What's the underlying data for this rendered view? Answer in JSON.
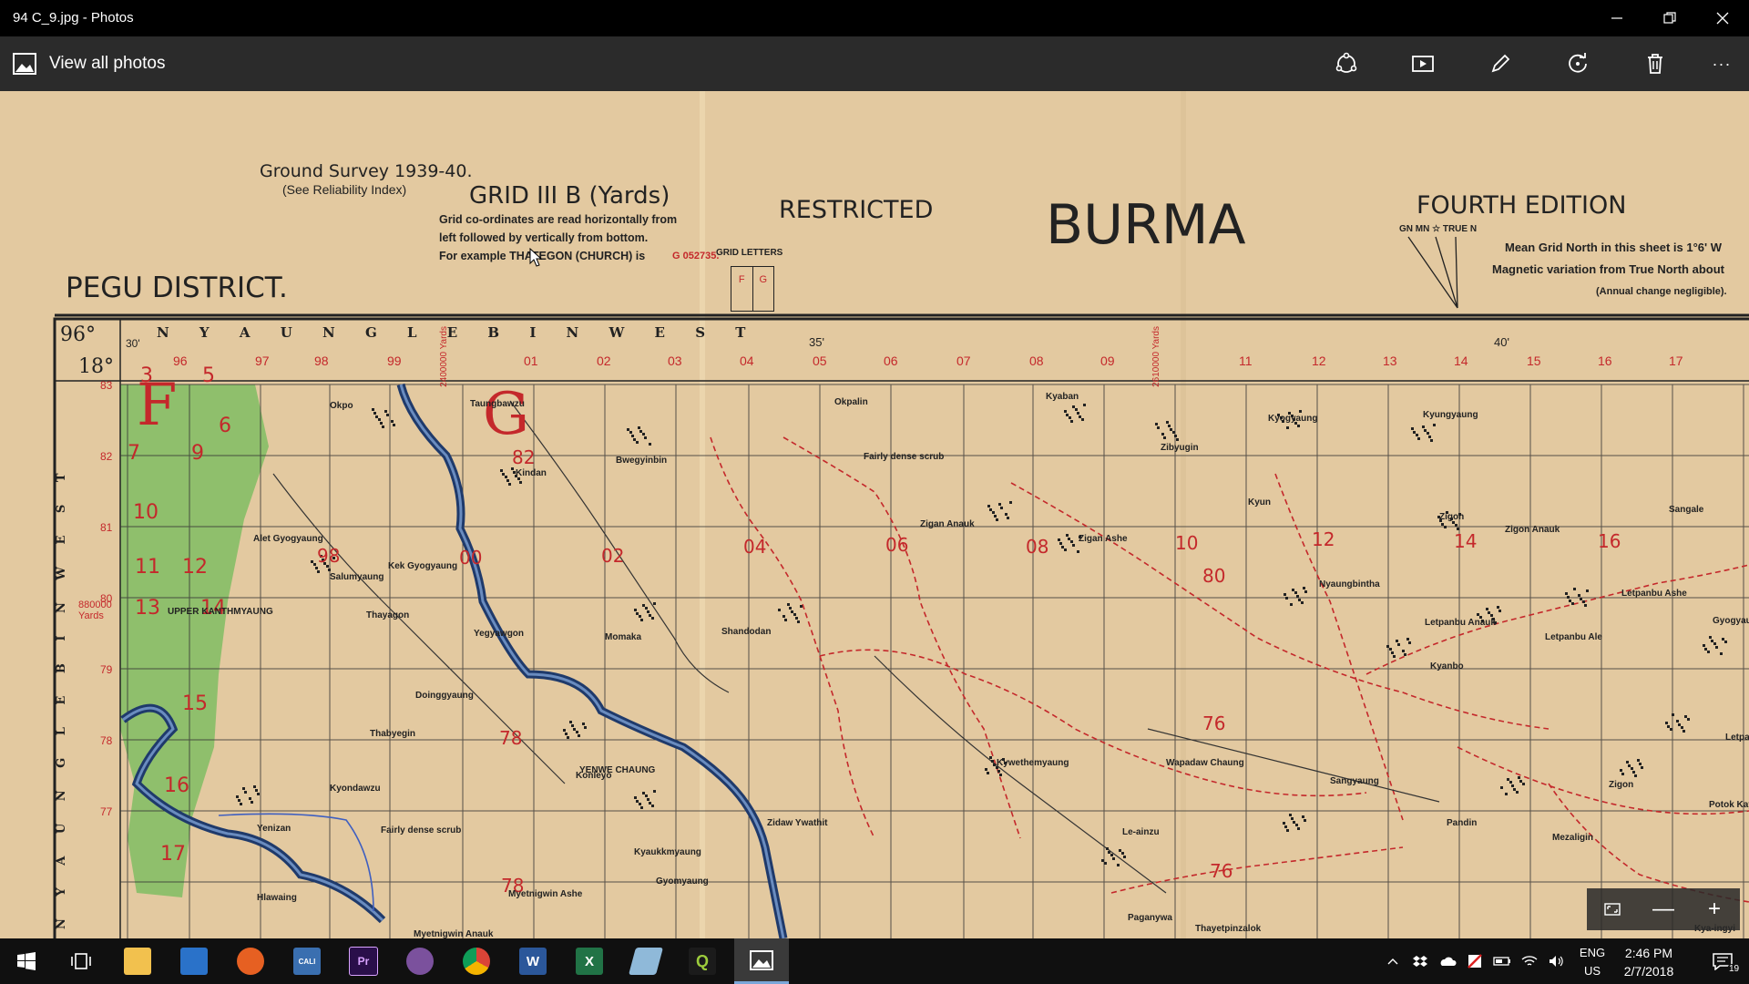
{
  "window": {
    "title": "94 C_9.jpg - Photos",
    "minimize_icon": "minimize-icon",
    "maximize_icon": "restore-icon",
    "close_icon": "close-icon"
  },
  "appbar": {
    "view_all_label": "View all photos",
    "tools": [
      "share-icon",
      "slideshow-icon",
      "edit-icon",
      "rotate-icon",
      "delete-icon",
      "more-icon"
    ],
    "more_label": "···"
  },
  "map": {
    "ground_survey": "Ground Survey 1939-40.",
    "reliability": "(See Reliability Index)",
    "grid_title": "GRID III B (Yards)",
    "grid_line1": "Grid co-ordinates are read horizontally from",
    "grid_line2": "left followed by vertically from bottom.",
    "grid_line3": "For example THATEGON (CHURCH) is",
    "grid_example": "G 052735.",
    "grid_letters": "GRID LETTERS",
    "grid_letter_f": "F",
    "grid_letter_g": "G",
    "restricted": "RESTRICTED",
    "country": "BURMA",
    "edition": "FOURTH EDITION",
    "north_labels": "GN MN ☆ TRUE N",
    "mean_grid": "Mean Grid North in this sheet is 1°6' W",
    "magnetic": "Magnetic variation from True North about",
    "annual": "(Annual change negligible).",
    "district": "PEGU DISTRICT.",
    "sheet_top": "N Y A U N G L E B I N   W E S T",
    "side_label": "N Y A U N G L E B I N   W E S T",
    "corner_96": "96°",
    "corner_18": "18°",
    "corner_30": "30'",
    "minute_35": "35'",
    "minute_40": "40'",
    "x_ticks": [
      "96",
      "97",
      "98",
      "99",
      "01",
      "02",
      "03",
      "04",
      "05",
      "06",
      "07",
      "08",
      "09",
      "11",
      "12",
      "13",
      "14",
      "15",
      "16",
      "17"
    ],
    "y_ticks": [
      "83",
      "82",
      "81",
      "80",
      "79",
      "78",
      "77"
    ],
    "yards_left": "880000 Yards",
    "yards_top1": "2400000 Yards",
    "yards_top2": "2610000 Yards",
    "red_labels": [
      "82",
      "02",
      "04",
      "06",
      "08",
      "10",
      "12",
      "14",
      "16",
      "80",
      "98",
      "78",
      "76",
      "78",
      "76",
      "00"
    ],
    "green_zone_numbers": [
      "3",
      "5",
      "6",
      "7",
      "9",
      "10",
      "11",
      "12",
      "13",
      "14",
      "15",
      "16",
      "17"
    ],
    "big_letters": [
      "F",
      "G"
    ],
    "places": [
      "Okpo",
      "Taungbawzu",
      "Kindan",
      "Bwegyinbin",
      "Okpalin",
      "Fairly dense scrub",
      "Kyaban",
      "Zibyugin",
      "Kyogyaung",
      "Kyungyaung",
      "Zigon",
      "Sangale",
      "Zigan Anauk",
      "Zigan Ashe",
      "Kyun",
      "Zigon Anauk",
      "Alet Gyogyaung",
      "Kek Gyogyaung",
      "Salumyaung",
      "Thayagon",
      "Yegyawgon",
      "Momaka",
      "Shandodan",
      "Nyaungbintha",
      "Letpanbu Ashe",
      "Letpanbu Anauk",
      "Letpanbu Ale",
      "Kyanbo",
      "Gyogyaung",
      "UPPER KANTHMYAUNG",
      "Doinggyaung",
      "Thabyegin",
      "Konleyo",
      "YENWE CHAUNG",
      "Kyaukkmyaung",
      "Gyomyaung",
      "Zidaw Ywathit",
      "Kywethemyaung",
      "Wapadaw Chaung",
      "Sangyaung",
      "Pandin",
      "Mezaligin",
      "Zigon",
      "Yenizan",
      "Kyondawzu",
      "Fairly dense scrub",
      "Hlawaing",
      "Myetnigwin Ashe",
      "Myetnigwin Anauk",
      "Le-ainzu",
      "Paganywa",
      "Thayetpinzalok",
      "Potok Kayin",
      "Kya-ingyi",
      "Letpan"
    ]
  },
  "zoom": {
    "fullscreen_icon": "fullscreen-icon",
    "minus": "—",
    "plus": "+"
  },
  "taskbar": {
    "apps": [
      "start-icon",
      "task-view-icon",
      "file-explorer-icon",
      "store-icon",
      "firefox-icon",
      "calibre-icon",
      "premiere-icon",
      "viber-icon",
      "chrome-icon",
      "word-icon",
      "excel-icon",
      "pen-icon",
      "qgis-icon",
      "photos-icon"
    ],
    "app_letters": {
      "calibre": "CALI",
      "premiere": "Pr",
      "word": "W",
      "excel": "X",
      "qgis": "Q"
    },
    "lang_top": "ENG",
    "lang_bottom": "US",
    "time": "2:46 PM",
    "date": "2/7/2018",
    "notification_count": "19"
  },
  "colors": {
    "map_bg": "#e3c9a0",
    "forest_green": "#8fbf6c",
    "river_blue": "#1f3a6b",
    "grid_red": "#c4282b",
    "appbar_bg": "#2b2b2b"
  }
}
